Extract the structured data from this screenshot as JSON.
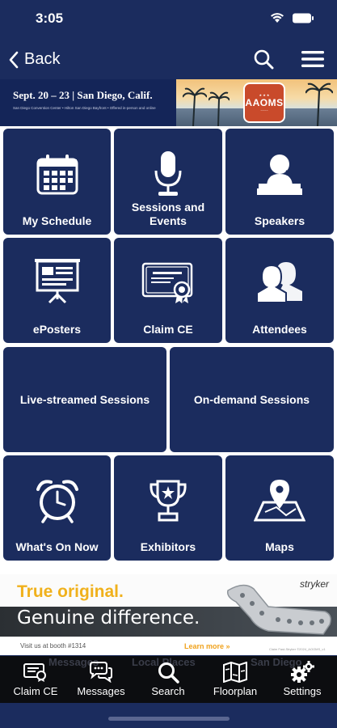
{
  "status": {
    "time": "3:05"
  },
  "nav": {
    "back_label": "Back"
  },
  "banner": {
    "dates": "Sept. 20 – 23 | San Diego, Calif.",
    "subtitle": "San Diego Convention Center • Hilton San Diego Bayfront • Offered in-person and online",
    "badge": "AAOMS"
  },
  "tiles": [
    {
      "label": "My Schedule",
      "icon": "calendar-icon"
    },
    {
      "label": "Sessions and Events",
      "icon": "microphone-icon"
    },
    {
      "label": "Speakers",
      "icon": "speaker-podium-icon"
    },
    {
      "label": "ePosters",
      "icon": "presentation-board-icon"
    },
    {
      "label": "Claim CE",
      "icon": "certificate-icon"
    },
    {
      "label": "Attendees",
      "icon": "people-icon"
    },
    {
      "label": "Live-streamed Sessions",
      "icon": ""
    },
    {
      "label": "On-demand Sessions",
      "icon": ""
    },
    {
      "label": "What's On Now",
      "icon": "alarm-clock-icon"
    },
    {
      "label": "Exhibitors",
      "icon": "trophy-icon"
    },
    {
      "label": "Maps",
      "icon": "map-pin-icon"
    }
  ],
  "ad": {
    "headline": "True original.",
    "brand": "stryker",
    "subheadline": "Genuine difference.",
    "visit": "Visit us at booth #1314",
    "cta": "Learn more »",
    "fine_print": "Claim Fast-Stryker ©2024_AOOMS_v1"
  },
  "tabbar": {
    "ghost_items": [
      "Messages",
      "Local Places",
      "San Diego"
    ],
    "tabs": [
      {
        "label": "Claim CE",
        "icon": "certificate-icon"
      },
      {
        "label": "Messages",
        "icon": "chat-bubbles-icon"
      },
      {
        "label": "Search",
        "icon": "search-icon"
      },
      {
        "label": "Floorplan",
        "icon": "floorplan-map-icon"
      },
      {
        "label": "Settings",
        "icon": "gears-icon"
      }
    ]
  },
  "colors": {
    "navy": "#1b2c5e",
    "accent_yellow": "#f0b11c",
    "tabbar": "#0c0d10"
  }
}
